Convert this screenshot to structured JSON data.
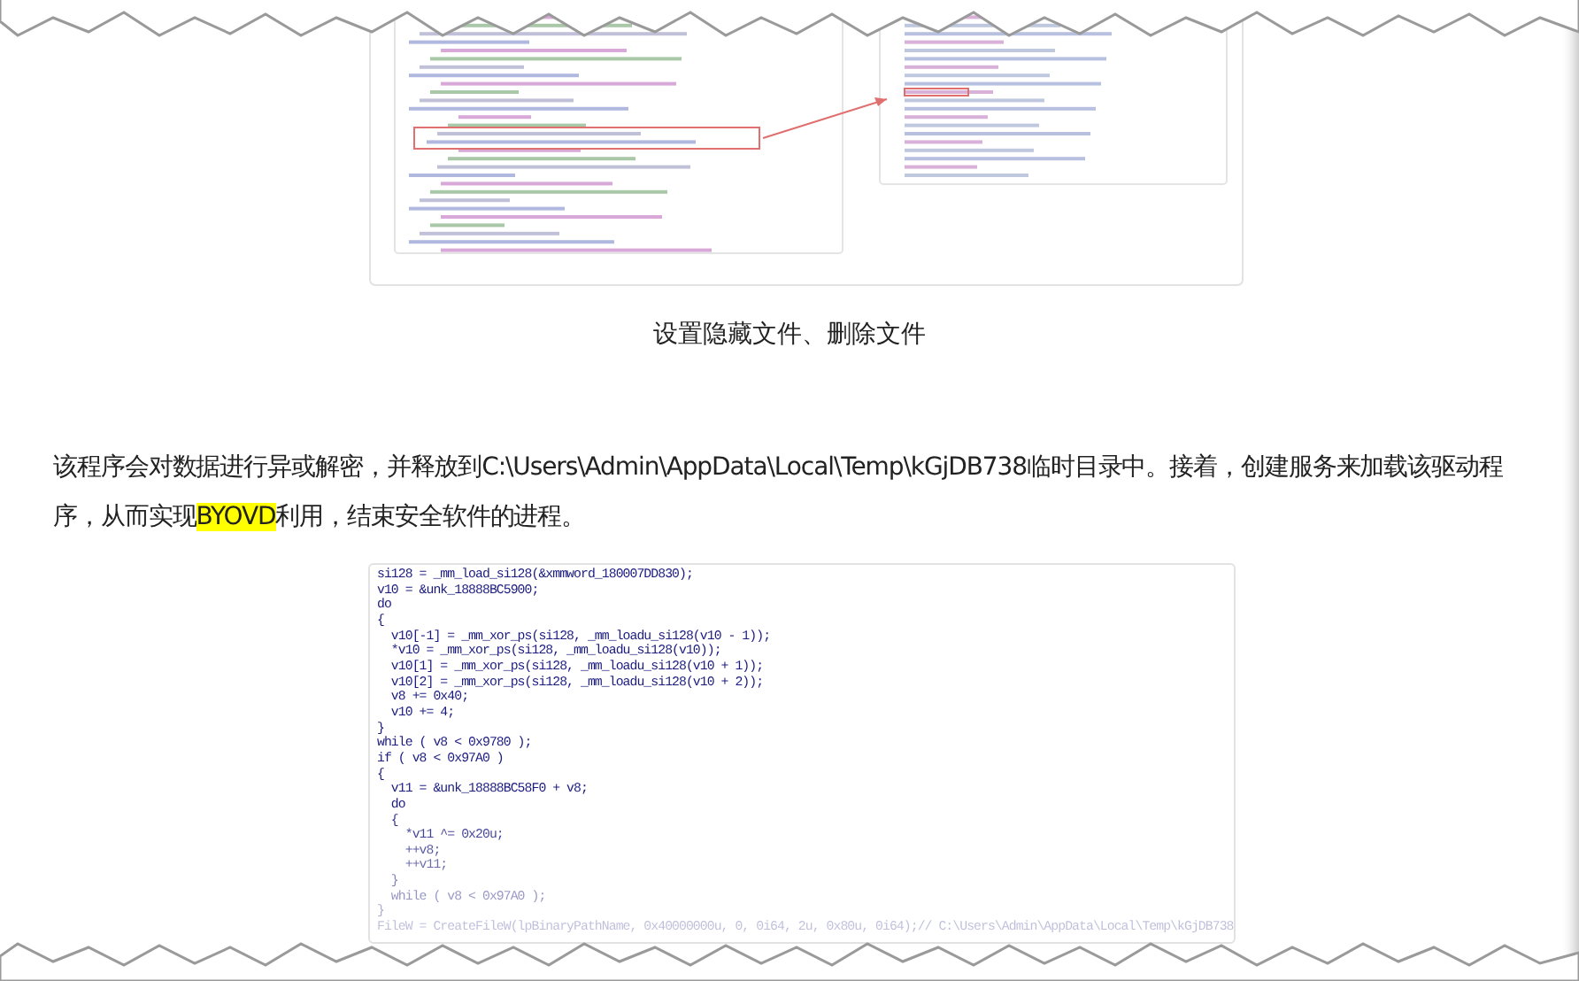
{
  "figure_caption": "设置隐藏文件、删除文件",
  "paragraph": [
    {
      "text": "该程序会对数据进行异或解密，并释放到C:\\Users\\Admin\\AppData\\Local\\Temp\\kGjDB738临时目录中。接着，创建服务来加载该驱动程序，从而实现",
      "highlighted": false
    },
    {
      "text": "BYOVD",
      "highlighted": true
    },
    {
      "text": "利用，结束安全软件的进程。",
      "highlighted": false
    }
  ],
  "code_lines": [
    "si128 = _mm_load_si128(&xmmword_180007DD830);",
    "v10 = &unk_18888BC5900;",
    "do",
    "{",
    "  v10[-1] = _mm_xor_ps(si128, _mm_loadu_si128(v10 - 1));",
    "  *v10 = _mm_xor_ps(si128, _mm_loadu_si128(v10));",
    "  v10[1] = _mm_xor_ps(si128, _mm_loadu_si128(v10 + 1));",
    "  v10[2] = _mm_xor_ps(si128, _mm_loadu_si128(v10 + 2));",
    "  v8 += 0x40;",
    "  v10 += 4;",
    "}",
    "while ( v8 < 0x9780 );",
    "if ( v8 < 0x97A0 )",
    "{",
    "  v11 = &unk_18888BC58F0 + v8;",
    "  do",
    "  {",
    "    *v11 ^= 0x20u;",
    "    ++v8;",
    "    ++v11;",
    "  }",
    "  while ( v8 < 0x97A0 );",
    "}",
    "FileW = CreateFileW(lpBinaryPathName, 0x40000000u, 0, 0i64, 2u, 0x80u, 0i64);// C:\\Users\\Admin\\AppData\\Local\\Temp\\kGjDB738"
  ]
}
